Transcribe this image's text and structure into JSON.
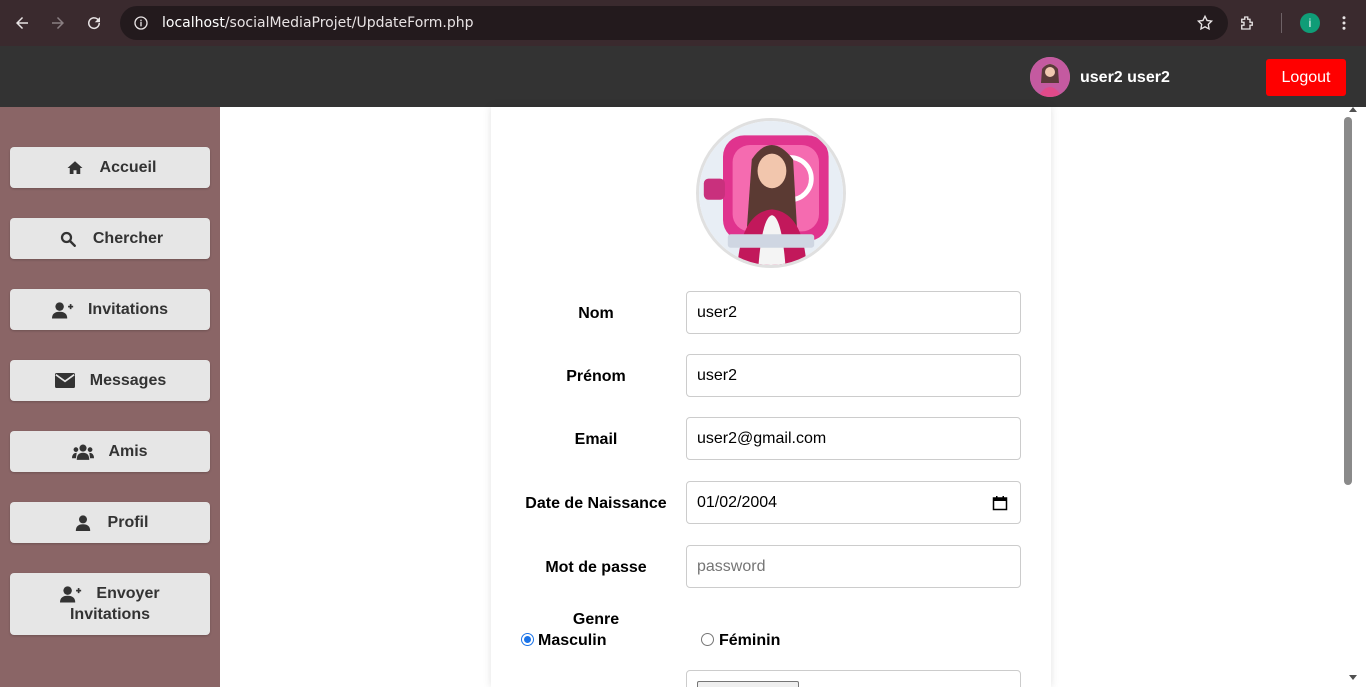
{
  "browser": {
    "url_host": "localhost",
    "url_path": "/socialMediaProjet/UpdateForm.php",
    "profile_initial": "i"
  },
  "header": {
    "username": "user2 user2",
    "logout_label": "Logout"
  },
  "sidebar": {
    "items": [
      {
        "label": "Accueil",
        "icon": "home-icon"
      },
      {
        "label": "Chercher",
        "icon": "search-icon"
      },
      {
        "label": "Invitations",
        "icon": "user-plus-icon"
      },
      {
        "label": "Messages",
        "icon": "envelope-icon"
      },
      {
        "label": "Amis",
        "icon": "users-icon"
      },
      {
        "label": "Profil",
        "icon": "user-icon"
      },
      {
        "label_line1": "Envoyer",
        "label_line2": "Invitations",
        "icon": "user-plus-icon"
      }
    ]
  },
  "form": {
    "nom_label": "Nom",
    "nom_value": "user2",
    "prenom_label": "Prénom",
    "prenom_value": "user2",
    "email_label": "Email",
    "email_value": "user2@gmail.com",
    "dob_label": "Date de Naissance",
    "dob_value": "01/02/2004",
    "password_label": "Mot de passe",
    "password_placeholder": "password",
    "genre_label": "Genre",
    "genre_options": [
      {
        "label": "Masculin",
        "checked": true
      },
      {
        "label": "Féminin",
        "checked": false
      }
    ]
  },
  "colors": {
    "sidebar_bg": "#8a6566",
    "topbar_bg": "#333333",
    "logout_bg": "#ff0000",
    "chrome_bg": "#3a2a2e"
  }
}
